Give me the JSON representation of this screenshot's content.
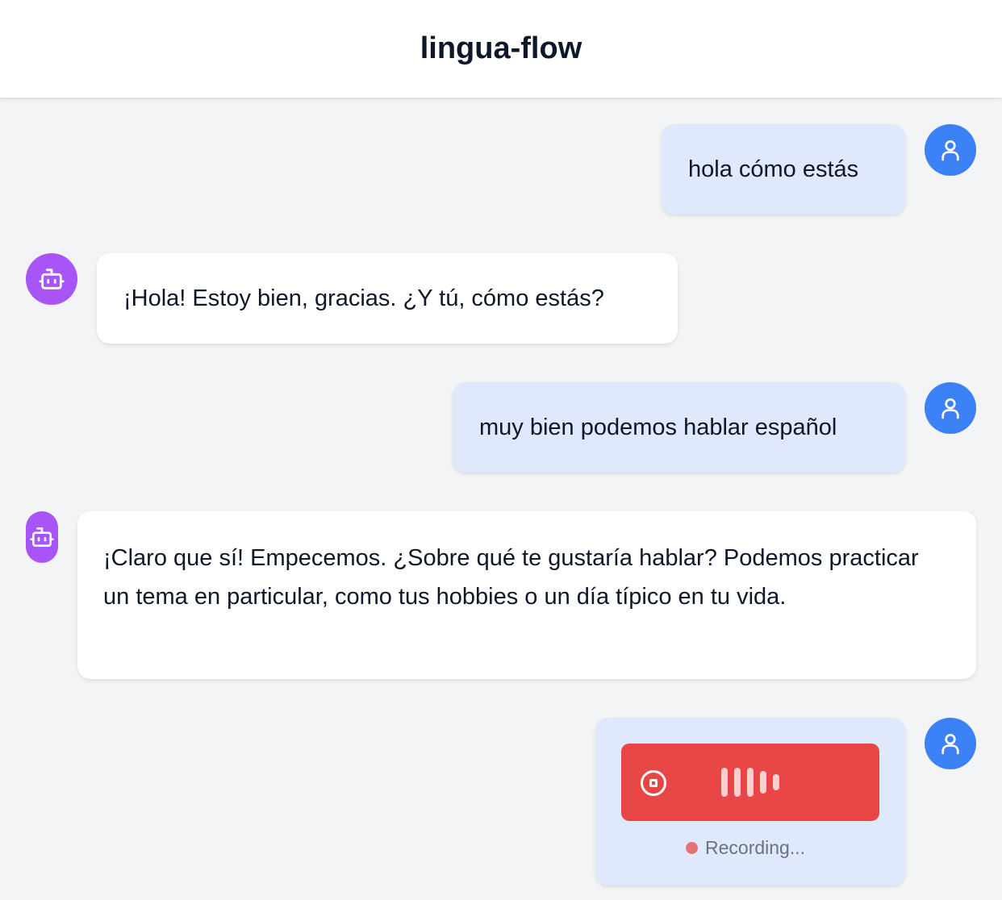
{
  "app": {
    "title": "lingua-flow"
  },
  "messages": [
    {
      "role": "user",
      "text": "hola cómo estás"
    },
    {
      "role": "assistant",
      "text": "¡Hola! Estoy bien, gracias. ¿Y tú, cómo estás?"
    },
    {
      "role": "user",
      "text": "muy bien podemos hablar español"
    },
    {
      "role": "assistant",
      "text": "¡Claro que sí! Empecemos. ¿Sobre qué te gustaría hablar? Podemos practicar un tema en particular, como tus hobbies o un día típico en tu vida."
    }
  ],
  "recording": {
    "status_text": "Recording...",
    "stop_icon": "stop-circle-icon",
    "waveform_icon": "audio-waveform-icon"
  },
  "icons": {
    "user": "user-icon",
    "assistant": "bot-icon"
  },
  "colors": {
    "user_avatar": "#3b82f6",
    "bot_avatar": "#a855f7",
    "user_bubble": "#dfe9fb",
    "bot_bubble": "#ffffff",
    "recorder": "#e84545",
    "background": "#f3f4f6"
  }
}
